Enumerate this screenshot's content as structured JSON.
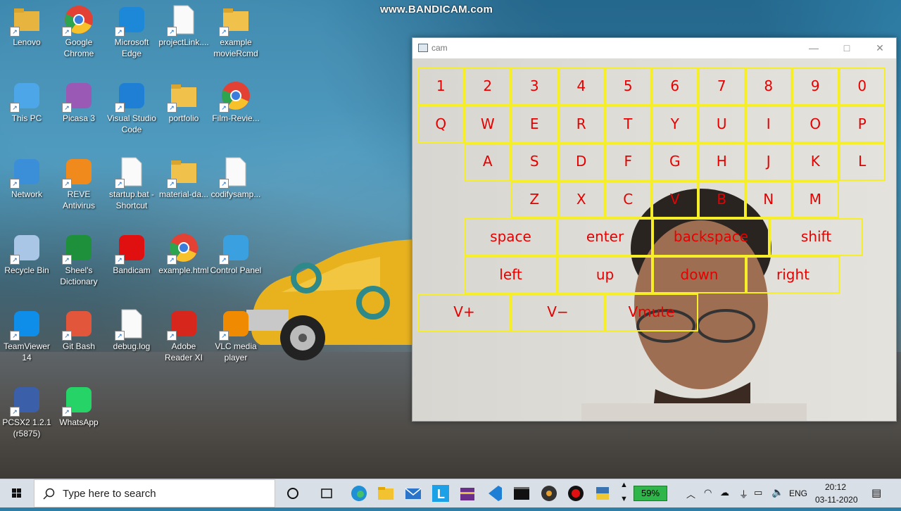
{
  "watermark": "www.BANDICAM.com",
  "desktop_icons": [
    {
      "label": "Lenovo",
      "icon": "user-folder-icon"
    },
    {
      "label": "Google Chrome",
      "icon": "chrome-icon"
    },
    {
      "label": "Microsoft Edge",
      "icon": "edge-icon"
    },
    {
      "label": "projectLink....",
      "icon": "document-icon"
    },
    {
      "label": "example movieRcmd",
      "icon": "folder-icon"
    },
    {
      "label": "This PC",
      "icon": "computer-icon"
    },
    {
      "label": "Picasa 3",
      "icon": "picasa-icon"
    },
    {
      "label": "Visual Studio Code",
      "icon": "vscode-icon"
    },
    {
      "label": "portfolio",
      "icon": "folder-icon"
    },
    {
      "label": "Film-Revie...",
      "icon": "chrome-folder-icon"
    },
    {
      "label": "Network",
      "icon": "network-icon"
    },
    {
      "label": "REVE Antivirus",
      "icon": "reve-antivirus-icon"
    },
    {
      "label": "startup.bat - Shortcut",
      "icon": "gear-file-icon"
    },
    {
      "label": "material-da...",
      "icon": "folder-icon"
    },
    {
      "label": "codifysamp...",
      "icon": "document-icon"
    },
    {
      "label": "Recycle Bin",
      "icon": "recycle-bin-icon"
    },
    {
      "label": "Sheel's Dictionary",
      "icon": "dictionary-icon"
    },
    {
      "label": "Bandicam",
      "icon": "bandicam-icon"
    },
    {
      "label": "example.html",
      "icon": "chrome-icon"
    },
    {
      "label": "Control Panel",
      "icon": "control-panel-icon"
    },
    {
      "label": "TeamViewer 14",
      "icon": "teamviewer-icon"
    },
    {
      "label": "Git Bash",
      "icon": "git-icon"
    },
    {
      "label": "debug.log",
      "icon": "document-icon"
    },
    {
      "label": "Adobe Reader XI",
      "icon": "adobe-reader-icon"
    },
    {
      "label": "VLC media player",
      "icon": "vlc-icon"
    },
    {
      "label": "PCSX2 1.2.1 (r5875)",
      "icon": "pcsx2-icon"
    },
    {
      "label": "WhatsApp",
      "icon": "whatsapp-icon"
    }
  ],
  "window": {
    "title": "cam",
    "minimize": "—",
    "maximize": "□",
    "close": "✕"
  },
  "keyboard": {
    "row1": [
      "1",
      "2",
      "3",
      "4",
      "5",
      "6",
      "7",
      "8",
      "9",
      "0"
    ],
    "row2": [
      "Q",
      "W",
      "E",
      "R",
      "T",
      "Y",
      "U",
      "I",
      "O",
      "P"
    ],
    "row3": [
      "A",
      "S",
      "D",
      "F",
      "G",
      "H",
      "J",
      "K",
      "L"
    ],
    "row4": [
      "Z",
      "X",
      "C",
      "V",
      "B",
      "N",
      "M"
    ],
    "row5": [
      "space",
      "enter",
      "backspace",
      "shift"
    ],
    "row6": [
      "left",
      "up",
      "down",
      "right"
    ],
    "row7": [
      "V+",
      "V−",
      "Vmute"
    ]
  },
  "taskbar": {
    "search_placeholder": "Type here to search",
    "battery": "59%",
    "language": "ENG",
    "time": "20:12",
    "date": "03-11-2020"
  }
}
